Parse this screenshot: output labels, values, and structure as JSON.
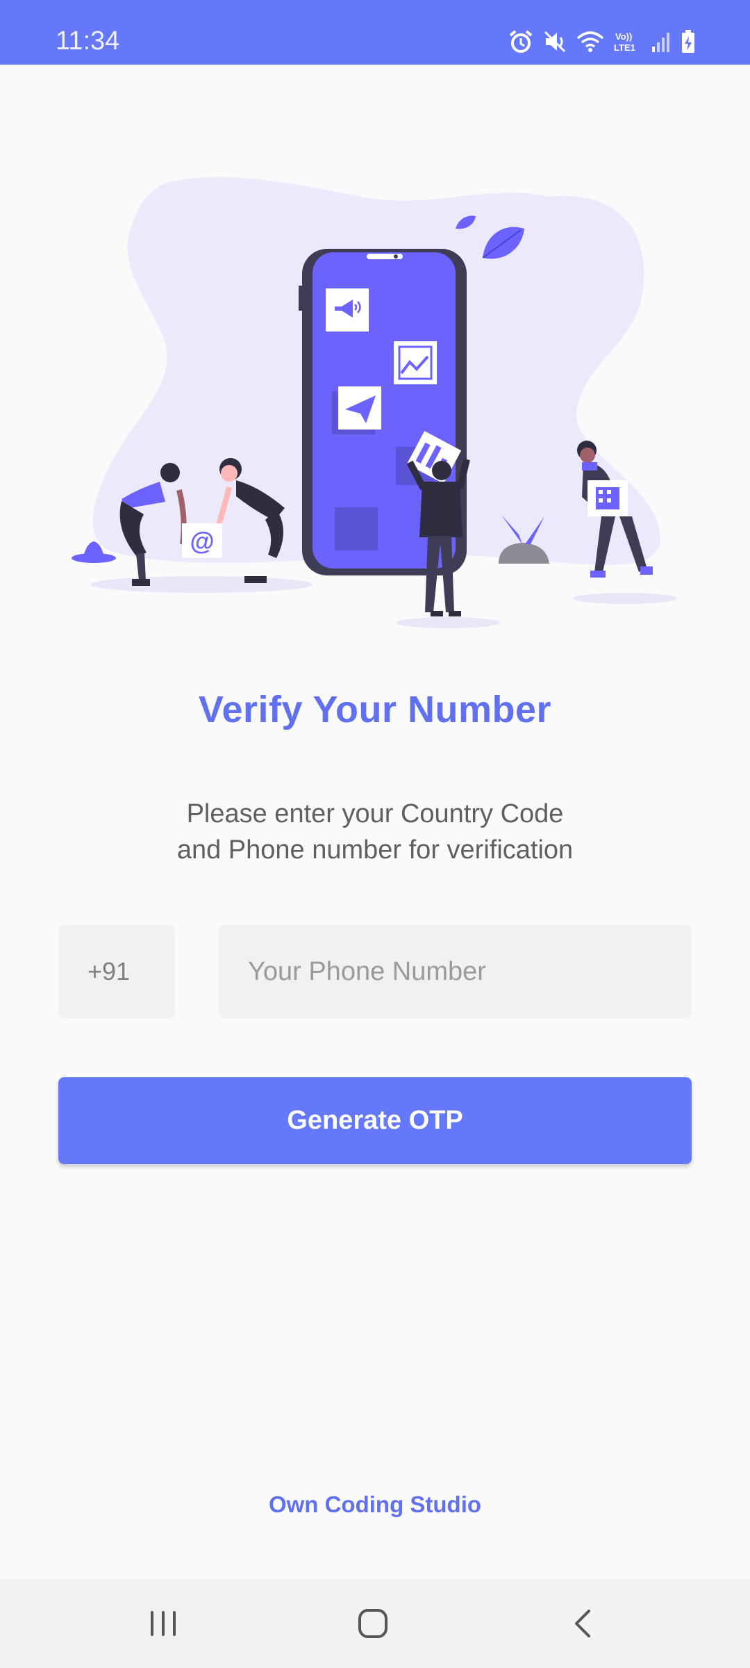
{
  "status_bar": {
    "time": "11:34",
    "icons": [
      "alarm-icon",
      "mute-icon",
      "wifi-icon",
      "volte-lte-icon",
      "signal-icon",
      "battery-charging-icon"
    ],
    "volte_label": "Vo)) LTE1",
    "background": "#6578fa"
  },
  "hero": {
    "illustration": "people-arranging-app-icons-around-phone",
    "accent": "#6c63ff"
  },
  "title": "Verify Your Number",
  "subtitle": {
    "line1": "Please enter your Country Code",
    "line2": "and Phone number for verification"
  },
  "form": {
    "country_code": "+91",
    "phone_placeholder": "Your Phone Number",
    "phone_value": ""
  },
  "button": {
    "label": "Generate OTP",
    "color": "#6578fa"
  },
  "footer": {
    "brand": "Own Coding Studio"
  },
  "nav_bar": {
    "icons": [
      "recent-apps-icon",
      "home-icon",
      "back-icon"
    ]
  }
}
